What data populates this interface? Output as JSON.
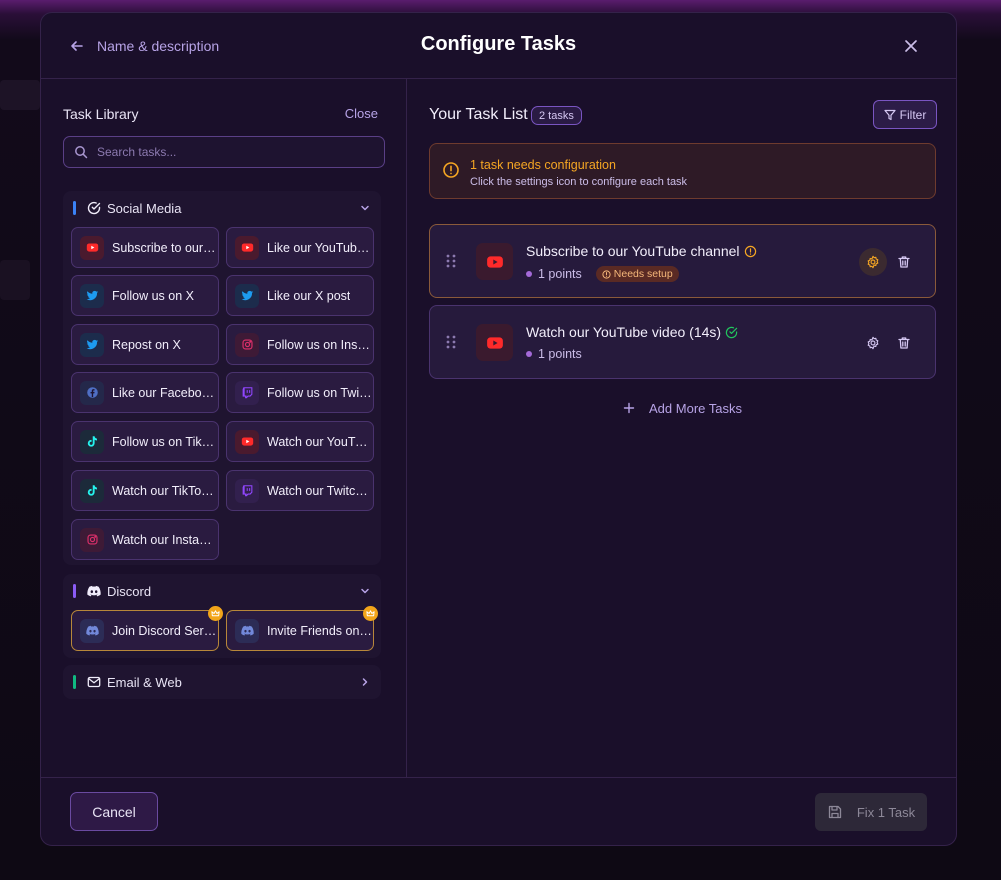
{
  "header": {
    "back_label": "Name & description",
    "title": "Configure Tasks"
  },
  "library": {
    "title": "Task Library",
    "close_label": "Close",
    "search_placeholder": "Search tasks...",
    "categories": [
      {
        "name": "Social Media",
        "accent": "#3b82f6",
        "expanded": true,
        "tiles": [
          {
            "label": "Subscribe to our YouTube channel",
            "icon": "youtube-icon"
          },
          {
            "label": "Like our YouTube video",
            "icon": "youtube-icon"
          },
          {
            "label": "Follow us on X",
            "icon": "twitter-icon"
          },
          {
            "label": "Like our X post",
            "icon": "twitter-icon"
          },
          {
            "label": "Repost on X",
            "icon": "twitter-icon"
          },
          {
            "label": "Follow us on Instagram",
            "icon": "instagram-icon"
          },
          {
            "label": "Like our Facebook page",
            "icon": "facebook-icon"
          },
          {
            "label": "Follow us on Twitch",
            "icon": "twitch-icon"
          },
          {
            "label": "Follow us on TikTok",
            "icon": "tiktok-icon"
          },
          {
            "label": "Watch our YouTube video",
            "icon": "youtube-icon"
          },
          {
            "label": "Watch our TikTok video",
            "icon": "tiktok-icon"
          },
          {
            "label": "Watch our Twitch stream",
            "icon": "twitch-icon"
          },
          {
            "label": "Watch our Instagram reel",
            "icon": "instagram-icon"
          }
        ]
      },
      {
        "name": "Discord",
        "accent": "#8b5cf6",
        "expanded": true,
        "tiles": [
          {
            "label": "Join Discord Server",
            "icon": "discord-icon",
            "premium": true
          },
          {
            "label": "Invite Friends on Discord",
            "icon": "discord-icon",
            "premium": true
          }
        ]
      },
      {
        "name": "Email & Web",
        "accent": "#10b981",
        "expanded": false,
        "tiles": []
      }
    ]
  },
  "task_list": {
    "title": "Your Task List",
    "count_label": "2 tasks",
    "filter_label": "Filter",
    "alert": {
      "title": "1 task needs configuration",
      "subtitle": "Click the settings icon to configure each task"
    },
    "tasks": [
      {
        "name": "Subscribe to our YouTube channel",
        "points": "1 points",
        "status": "needs-setup",
        "badge": "Needs setup"
      },
      {
        "name": "Watch our YouTube video (14s)",
        "points": "1 points",
        "status": "configured"
      }
    ],
    "add_more_label": "Add More Tasks"
  },
  "footer": {
    "cancel_label": "Cancel",
    "fix_label": "Fix 1 Task"
  },
  "colors": {
    "youtube": "#ff2a2a",
    "twitter": "#1d9bf0",
    "instagram": "#e1306c",
    "facebook": "#4f6fc4",
    "twitch": "#9146ff",
    "tiktok": "#25f4ee",
    "discord": "#7289da",
    "warning": "#f5a623",
    "success": "#22c55e"
  }
}
